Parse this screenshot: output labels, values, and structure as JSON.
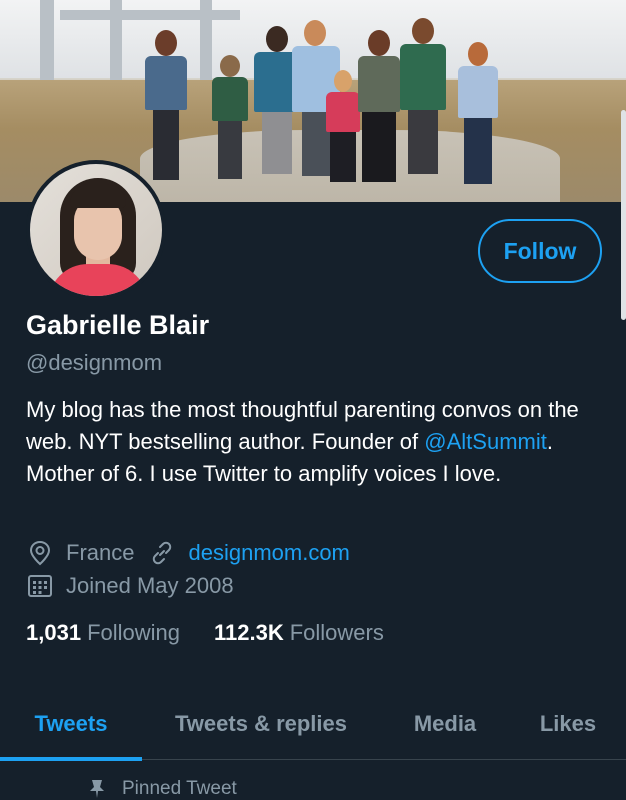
{
  "profile": {
    "display_name": "Gabrielle Blair",
    "handle": "@designmom",
    "bio_part1": "My blog has the most thoughtful parenting convos on the web. NYT bestselling author. Founder of ",
    "bio_mention": "@AltSummit",
    "bio_part2": ". Mother of 6. I use Twitter to amplify voices I love.",
    "location": "France",
    "website": "designmom.com",
    "joined": "Joined May 2008"
  },
  "actions": {
    "follow_label": "Follow"
  },
  "stats": {
    "following_count": "1,031",
    "following_label": "Following",
    "followers_count": "112.3K",
    "followers_label": "Followers"
  },
  "tabs": [
    {
      "label": "Tweets",
      "active": true
    },
    {
      "label": "Tweets & replies",
      "active": false
    },
    {
      "label": "Media",
      "active": false
    },
    {
      "label": "Likes",
      "active": false
    }
  ],
  "pinned": {
    "label": "Pinned Tweet"
  },
  "icons": {
    "location": "location-pin-icon",
    "website": "link-icon",
    "joined": "calendar-icon",
    "pinned": "pin-icon"
  },
  "colors": {
    "background": "#15202b",
    "accent": "#1da1f2",
    "secondary_text": "#8899a6",
    "primary_text": "#ffffff"
  }
}
